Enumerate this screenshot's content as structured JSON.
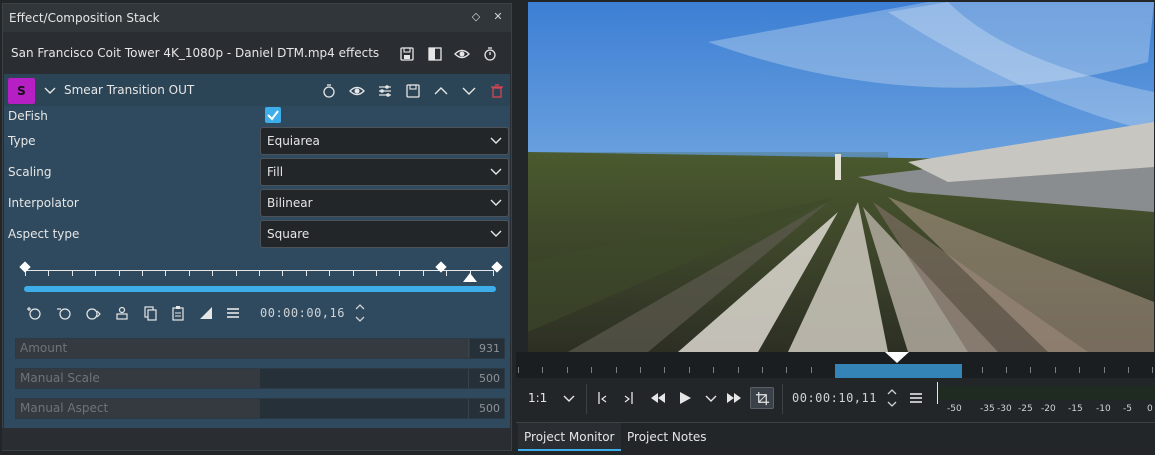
{
  "dock": {
    "title": "Effect/Composition Stack",
    "clip_title": "San Francisco Coit Tower 4K_1080p - Daniel DTM.mp4 effects"
  },
  "effect": {
    "badge": "S",
    "name": "Smear Transition OUT",
    "badge_color": "#b51fc3",
    "params": {
      "defish_label": "DeFish",
      "defish_checked": true,
      "type_label": "Type",
      "type_value": "Equiarea",
      "scaling_label": "Scaling",
      "scaling_value": "Fill",
      "interpolator_label": "Interpolator",
      "interpolator_value": "Bilinear",
      "aspect_label": "Aspect type",
      "aspect_value": "Square"
    },
    "keyframe_timecode": "00:00:00,16",
    "sliders": [
      {
        "name": "Amount",
        "value": "931",
        "fraction": 0.93
      },
      {
        "name": "Manual Scale",
        "value": "500",
        "fraction": 0.5
      },
      {
        "name": "Manual Aspect",
        "value": "500",
        "fraction": 0.5
      }
    ]
  },
  "monitor": {
    "zoom": "1:1",
    "timecode": "00:00:10,11",
    "vu_labels": [
      "-50",
      "-35",
      "-30",
      "-25",
      "-20",
      "-15",
      "-10",
      "-5",
      "0"
    ]
  },
  "tabs": [
    {
      "label": "Project Monitor",
      "active": true
    },
    {
      "label": "Project Notes",
      "active": false
    }
  ],
  "colors": {
    "accent": "#3daee9",
    "panel": "#2f4a5e",
    "background": "#232629"
  },
  "icons": {
    "dock": [
      "float-icon",
      "close-icon"
    ],
    "clip": [
      "save-stack-icon",
      "compare-icon",
      "eye-icon",
      "timer-icon"
    ],
    "effect_header": [
      "timer-icon",
      "eye-icon",
      "sliders-icon",
      "save-icon",
      "chevron-up-icon",
      "chevron-down-icon",
      "trash-icon"
    ],
    "keyframe_tools": [
      "add-keyframe-icon",
      "remove-keyframe-icon",
      "jump-keyframe-icon",
      "reset-icon",
      "copy-icon",
      "paste-icon",
      "curve-icon",
      "menu-icon"
    ]
  }
}
